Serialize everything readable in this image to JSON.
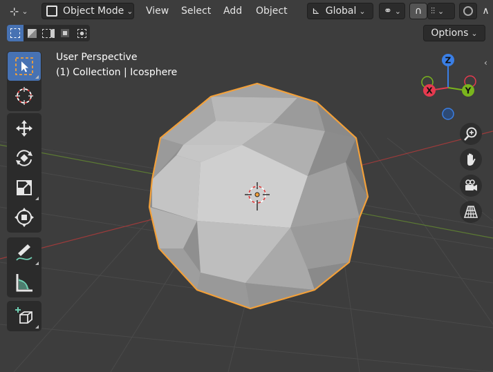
{
  "header": {
    "mode_label": "Object Mode",
    "menus": [
      "View",
      "Select",
      "Add",
      "Object"
    ],
    "orientation_label": "Global",
    "options_label": "Options"
  },
  "overlay": {
    "perspective": "User Perspective",
    "collection": "(1) Collection | Icosphere"
  },
  "gizmo": {
    "x_label": "X",
    "y_label": "Y",
    "z_label": "Z"
  },
  "colors": {
    "active_blue": "#4772b3",
    "selection_outline": "#f2a03a",
    "axis_x": "#e63a4f",
    "axis_y": "#7ab51d",
    "axis_z": "#3a7fe6"
  }
}
